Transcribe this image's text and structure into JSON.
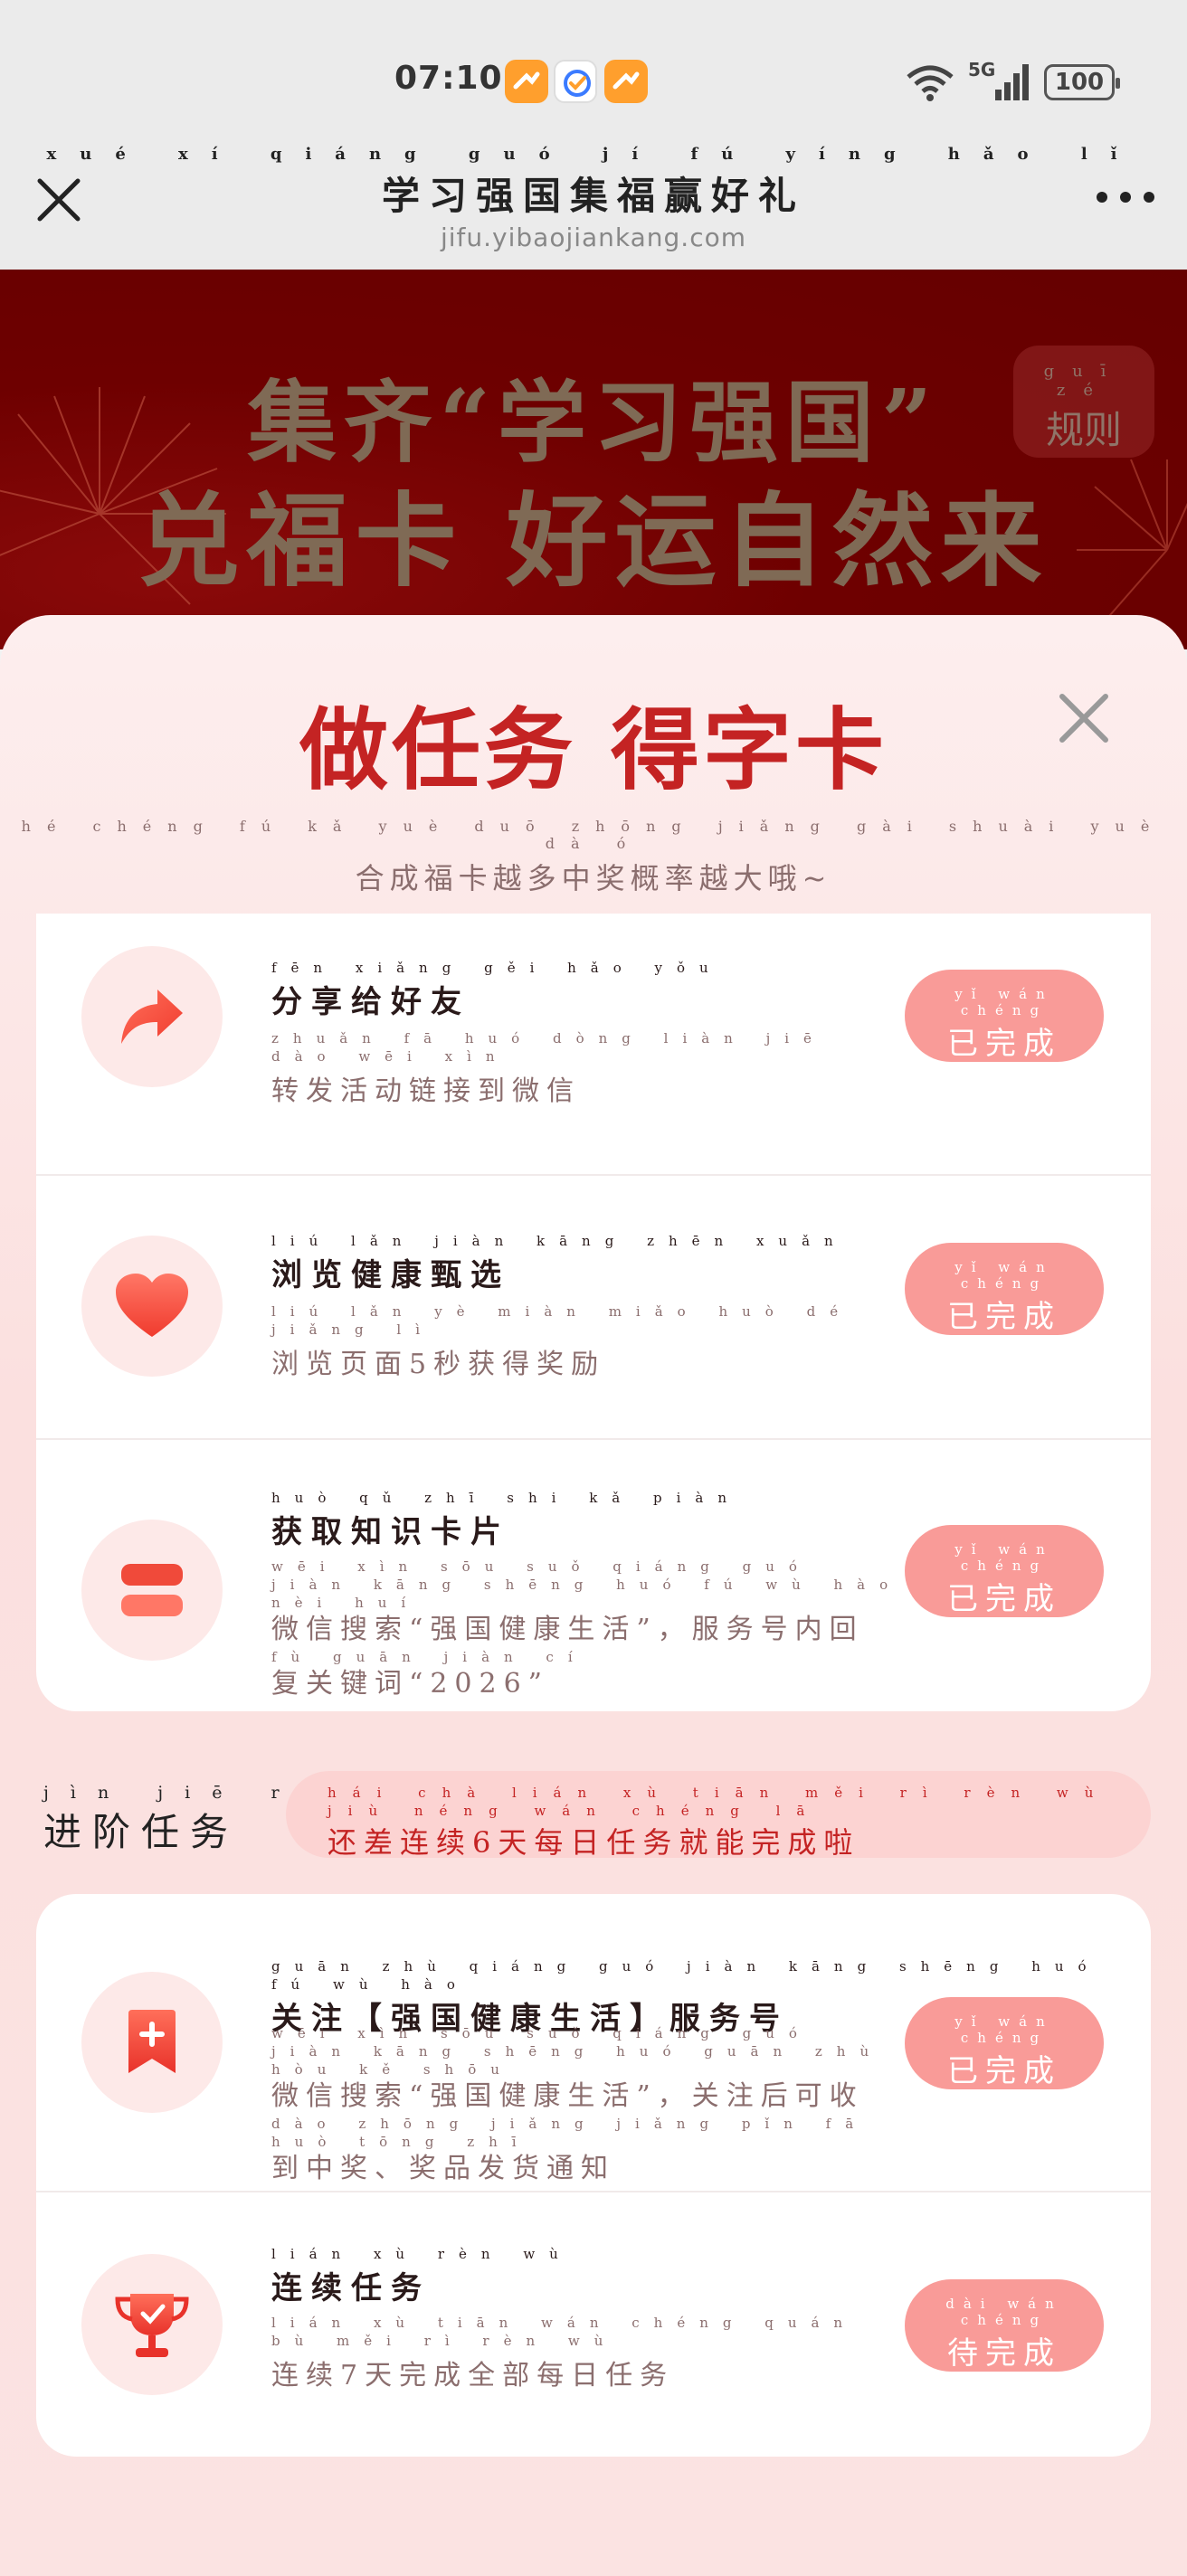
{
  "status_bar": {
    "time": "07:10",
    "network": "5G",
    "battery": "100"
  },
  "title_bar": {
    "title": "学习强国集福赢好礼",
    "title_pinyin": "xué xí qiáng guó jí fú yíng hǎo lǐ",
    "url": "jifu.yibaojiankang.com"
  },
  "banner": {
    "line1": "集齐“学习强国”",
    "line2": "兑福卡 好运自然来",
    "rules_label": "规则",
    "rules_pinyin": "guī zé"
  },
  "sheet": {
    "title": "做任务 得字卡",
    "subtitle": "合成福卡越多中奖概率越大哦~",
    "subtitle_pinyin": "hé chéng fú kǎ yuè duō zhōng jiǎng gài shuài yuè dà ó"
  },
  "tasks": [
    {
      "title": "分享给好友",
      "title_pinyin": "fēn xiǎng gěi hǎo yǒu",
      "desc": "转发活动链接到微信",
      "desc_pinyin": "zhuǎn fā huó dòng liàn jiē dào wēi xìn",
      "status": "已完成",
      "status_pinyin": "yǐ wán chéng",
      "icon": "share-icon"
    },
    {
      "title": "浏览健康甄选",
      "title_pinyin": "liú lǎn jiàn kāng zhēn xuǎn",
      "desc": "浏览页面5秒获得奖励",
      "desc_pinyin": "liú lǎn yè miàn miǎo huò dé jiǎng lì",
      "status": "已完成",
      "status_pinyin": "yǐ wán chéng",
      "icon": "heart-icon"
    },
    {
      "title": "获取知识卡片",
      "title_pinyin": "huò qǔ zhī shi kǎ piàn",
      "desc": "微信搜索“强国健康生活”，服务号内回",
      "desc_pinyin": "wēi xìn sōu suǒ qiáng guó jiàn kāng shēng huó fú wù hào nèi huí",
      "desc2": "复关键词“2026”",
      "desc2_pinyin": "fù guān jiàn cí",
      "status": "已完成",
      "status_pinyin": "yǐ wán chéng",
      "icon": "card-stack-icon"
    }
  ],
  "advanced": {
    "label": "进阶任务",
    "label_pinyin": "jìn jiē rèn wù",
    "hint": "还差连续6天每日任务就能完成啦",
    "hint_pinyin": "hái chà lián xù tiān měi rì rèn wù jiù néng wán chéng lā"
  },
  "advanced_tasks": [
    {
      "title": "关注【强国健康生活】服务号",
      "title_pinyin": "guān zhù qiáng guó jiàn kāng shēng huó fú wù hào",
      "desc": "微信搜索“强国健康生活”，关注后可收",
      "desc_pinyin": "wēi xìn sōu suǒ qiáng guó jiàn kāng shēng huó guān zhù hòu kě shōu",
      "desc2": "到中奖、奖品发货通知",
      "desc2_pinyin": "dào zhōng jiǎng jiǎng pǐn fā huò tōng zhī",
      "status": "已完成",
      "status_pinyin": "yǐ wán chéng",
      "icon": "bookmark-plus-icon"
    },
    {
      "title": "连续任务",
      "title_pinyin": "lián xù rèn wù",
      "desc": "连续7天完成全部每日任务",
      "desc_pinyin": "lián xù tiān wán chéng quán bù měi rì rèn wù",
      "status": "待完成",
      "status_pinyin": "dài wán chéng",
      "icon": "trophy-icon"
    }
  ],
  "colors": {
    "accent_red": "#c42323",
    "button_pink": "#f99b98",
    "banner_dark": "#6e0000"
  }
}
